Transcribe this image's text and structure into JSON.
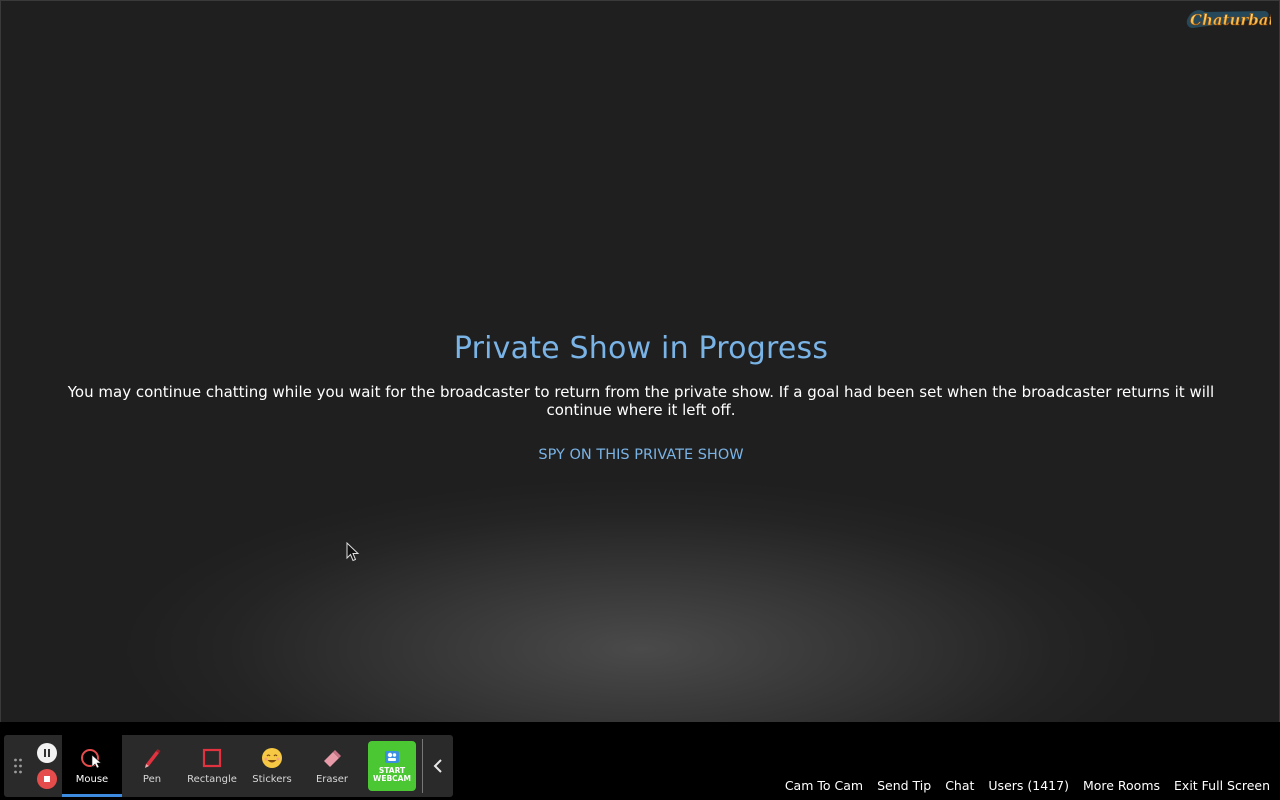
{
  "brand": {
    "logo_text": "Chaturbate"
  },
  "message": {
    "title": "Private Show in Progress",
    "description": "You may continue chatting while you wait for the broadcaster to return from the private show. If a goal had been set when the broadcaster returns it will continue where it left off.",
    "spy_link": "SPY ON THIS PRIVATE SHOW"
  },
  "toolbar": {
    "tools": [
      {
        "label": "Mouse",
        "icon": "mouse-pointer-icon",
        "active": true
      },
      {
        "label": "Pen",
        "icon": "pen-icon",
        "active": false
      },
      {
        "label": "Rectangle",
        "icon": "rectangle-icon",
        "active": false
      },
      {
        "label": "Stickers",
        "icon": "sticker-smiley-icon",
        "active": false
      },
      {
        "label": "Eraser",
        "icon": "eraser-icon",
        "active": false
      }
    ],
    "webcam_label_line1": "START",
    "webcam_label_line2": "WEBCAM"
  },
  "nav": {
    "cam_to_cam": "Cam To Cam",
    "send_tip": "Send Tip",
    "chat": "Chat",
    "users": "Users (1417)",
    "more_rooms": "More Rooms",
    "exit_full_screen": "Exit Full Screen"
  },
  "colors": {
    "accent_blue": "#7ab3e6",
    "webcam_green": "#4bc734",
    "stop_red": "#e54d4d",
    "active_underline": "#3d8be0"
  }
}
